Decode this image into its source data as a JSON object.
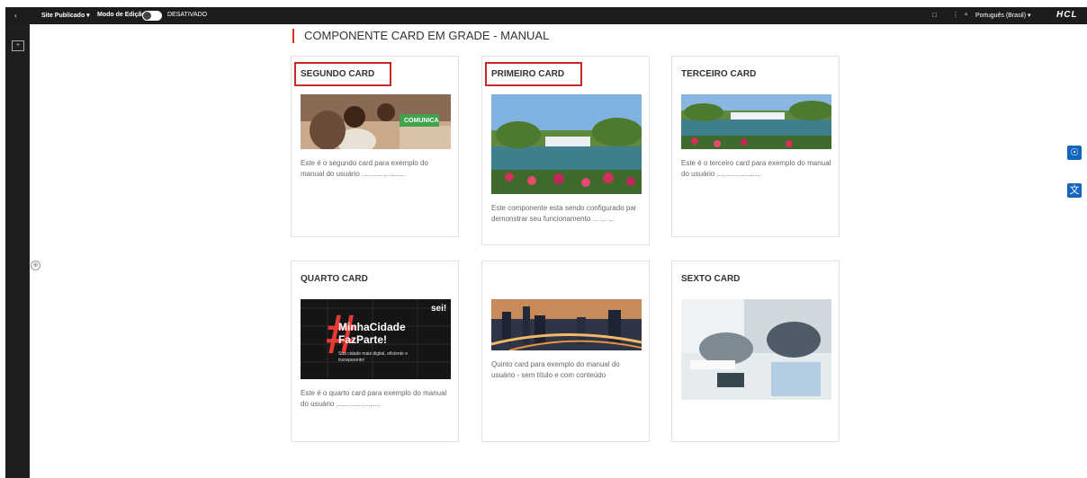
{
  "topbar": {
    "back_icon": "chevron-left-icon",
    "site_label": "Site Publicado ▾",
    "mode_label": "Modo de Edição",
    "mode_state": "DESATIVADO",
    "language": "Português (Brasil) ▾",
    "logo": "HCL"
  },
  "heading": "COMPONENTE CARD EM GRADE - MANUAL",
  "cards": [
    {
      "title": "SEGUNDO CARD",
      "desc": "Este é o segundo card para exemplo do manual do usuário ......................",
      "image": "child-photo",
      "badge": "COMUNICA"
    },
    {
      "title": "PRIMEIRO CARD",
      "desc": "Este componente esta sendo configurado par demonstrar seu funcionamento ... ... ...",
      "image": "lake-fountain-photo"
    },
    {
      "title": "TERCEIRO CARD",
      "desc": "Este é o terceiro card para exemplo do manual do usuário ......................",
      "image": "lake-fountain-photo"
    },
    {
      "title": "QUARTO CARD",
      "desc": "Este é o quarto card para exemplo do manual do usuário ......................",
      "image": "minhacidade-banner",
      "banner_line1": "MinhaCidade",
      "banner_line2": "FazParte!",
      "banner_small": "Sua cidade mais digital, eficiente e transparente!",
      "banner_brand": "sei!"
    },
    {
      "title": "",
      "desc": "Quinto card para exemplo do manual do usuário -  sem título e com conteúdo",
      "image": "city-night-photo"
    },
    {
      "title": "SEXTO CARD",
      "desc": "",
      "image": "business-meeting-photo"
    }
  ],
  "right_buttons": [
    "accessibility-icon",
    "translate-icon"
  ],
  "colors": {
    "accent": "#d32f2f",
    "topbar": "#1c1c1c",
    "right_button": "#1565c0"
  }
}
